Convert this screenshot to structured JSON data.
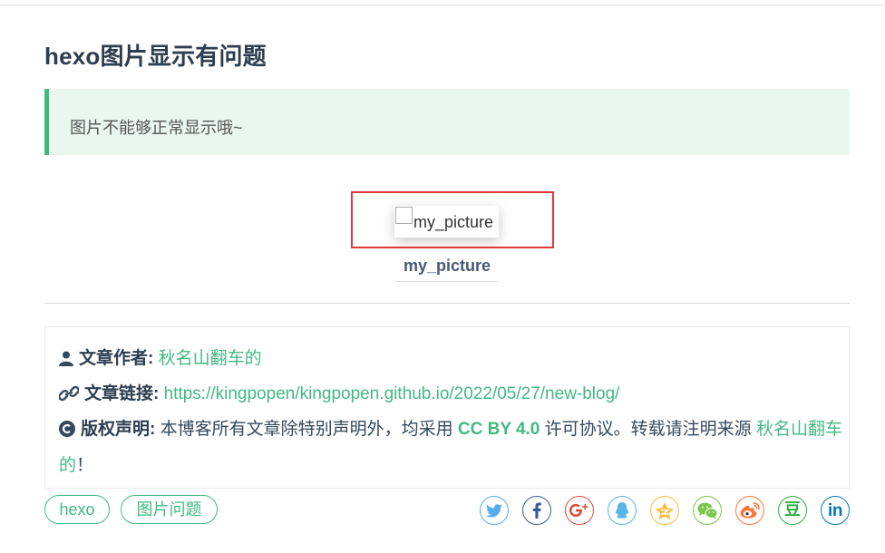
{
  "post": {
    "title": "hexo图片显示有问题",
    "note": "图片不能够正常显示哦~"
  },
  "figure": {
    "alt_text": "my_picture",
    "caption": "my_picture"
  },
  "copyright": {
    "author_label": "文章作者:",
    "author_name": "秋名山翻车的",
    "link_label": "文章链接:",
    "link_url": "https://kingpopen/kingpopen.github.io/2022/05/27/new-blog/",
    "notice_label": "版权声明:",
    "notice_text": "本博客所有文章除特别声明外，均采用",
    "license": "CC BY 4.0",
    "notice_text2": "许可协议。转载请注明来源",
    "source_part1": "秋名山翻车",
    "source_part2": "的",
    "exclaim": "！"
  },
  "tags": [
    "hexo",
    "图片问题"
  ],
  "share": {
    "icons": [
      "twitter-icon",
      "facebook-icon",
      "google-plus-icon",
      "qq-icon",
      "qzone-icon",
      "wechat-icon",
      "weibo-icon",
      "douban-icon",
      "linkedin-icon"
    ],
    "colors": {
      "twitter": "#55acee",
      "facebook": "#3b5998",
      "google_plus": "#dd4b39",
      "qq": "#56b6e7",
      "qzone": "#fdbe3d",
      "wechat": "#7bc549",
      "weibo": "#ff763b",
      "douban": "#33b045",
      "linkedin": "#0077b5"
    },
    "douban_glyph": "豆",
    "linkedin_glyph": "in"
  },
  "theme": {
    "accent": "#42b983",
    "highlight_border": "#e0393b"
  }
}
